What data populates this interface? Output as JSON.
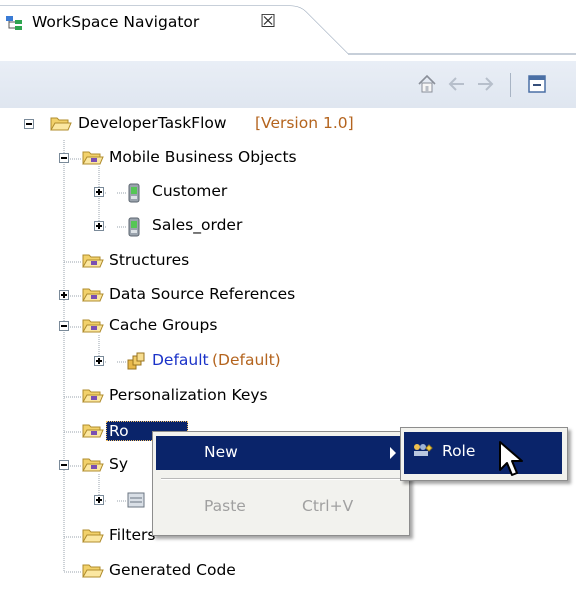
{
  "tab": {
    "title": "WorkSpace Navigator",
    "close_glyph": "☒"
  },
  "toolbar": {
    "buttons": [
      "home-icon",
      "back-arrow-icon",
      "forward-arrow-icon",
      "collapse-all-icon"
    ]
  },
  "tree": {
    "root": {
      "label": "DeveloperTaskFlow",
      "version": "[Version 1.0]"
    },
    "mobile_business_objects": "Mobile Business Objects",
    "customer": "Customer",
    "sales_order": "Sales_order",
    "structures": "Structures",
    "data_source_references": "Data Source References",
    "cache_groups": "Cache Groups",
    "default": {
      "label": "Default",
      "suffix": "(Default)"
    },
    "personalization_keys": "Personalization Keys",
    "roles_visible": "Ro",
    "sy_visible": "Sy",
    "filters": "Filters",
    "generated_code": "Generated Code"
  },
  "context_menu": {
    "new_label": "New",
    "paste_label": "Paste",
    "paste_shortcut": "Ctrl+V"
  },
  "submenu": {
    "role_label": "Role"
  },
  "colors": {
    "selection": "#0a246a",
    "link_blue": "#1a32c8",
    "annotation": "#b4641e"
  }
}
